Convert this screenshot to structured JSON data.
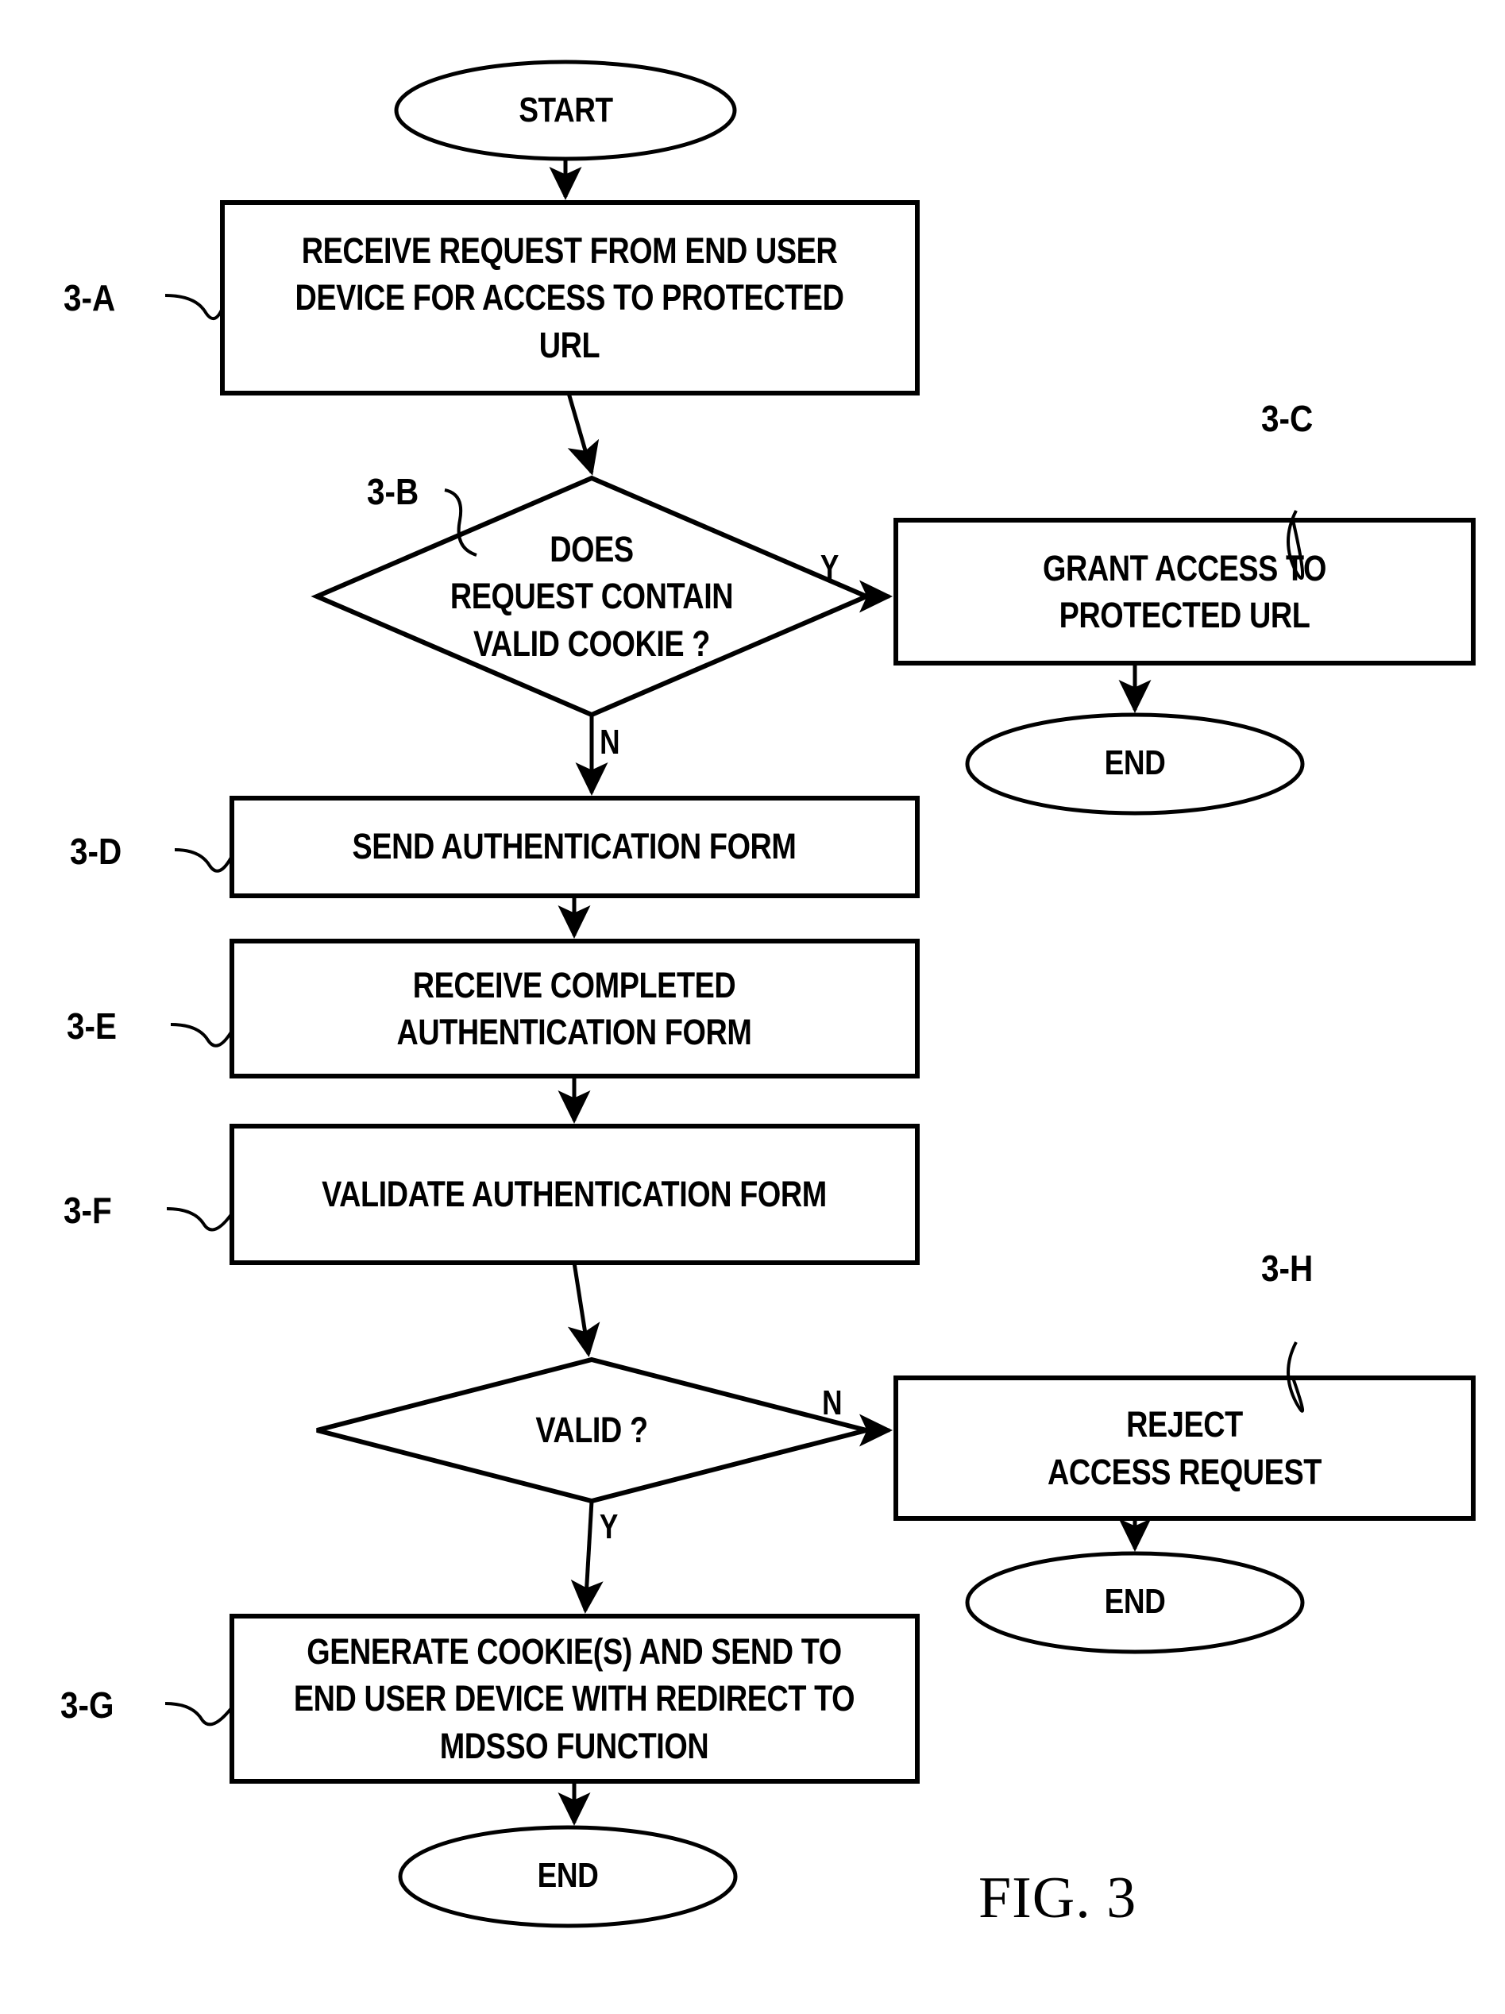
{
  "figure": {
    "caption": "FIG. 3",
    "colors": {
      "stroke": "#000000",
      "background": "#ffffff",
      "text": "#000000"
    }
  },
  "nodes": {
    "start": {
      "id": "start",
      "shape": "terminator",
      "label": "START"
    },
    "step_a": {
      "id": "3-A",
      "shape": "process",
      "ref": "3-A",
      "lines": [
        "RECEIVE REQUEST FROM END USER",
        "DEVICE FOR ACCESS TO PROTECTED",
        "URL"
      ]
    },
    "decision_b": {
      "id": "3-B",
      "shape": "decision",
      "ref": "3-B",
      "lines": [
        "DOES",
        "REQUEST CONTAIN",
        "VALID COOKIE ?"
      ]
    },
    "step_c": {
      "id": "3-C",
      "shape": "process",
      "ref": "3-C",
      "lines": [
        "GRANT ACCESS TO",
        "PROTECTED URL"
      ]
    },
    "end_c": {
      "id": "end-grant",
      "shape": "terminator",
      "label": "END"
    },
    "step_d": {
      "id": "3-D",
      "shape": "process",
      "ref": "3-D",
      "lines": [
        "SEND AUTHENTICATION FORM"
      ]
    },
    "step_e": {
      "id": "3-E",
      "shape": "process",
      "ref": "3-E",
      "lines": [
        "RECEIVE COMPLETED",
        "AUTHENTICATION FORM"
      ]
    },
    "step_f": {
      "id": "3-F",
      "shape": "process",
      "ref": "3-F",
      "lines": [
        "VALIDATE AUTHENTICATION FORM"
      ]
    },
    "decision_valid": {
      "id": "valid",
      "shape": "decision",
      "lines": [
        "VALID ?"
      ]
    },
    "step_h": {
      "id": "3-H",
      "shape": "process",
      "ref": "3-H",
      "lines": [
        "REJECT",
        "ACCESS REQUEST"
      ]
    },
    "end_h": {
      "id": "end-reject",
      "shape": "terminator",
      "label": "END"
    },
    "step_g": {
      "id": "3-G",
      "shape": "process",
      "ref": "3-G",
      "lines": [
        "GENERATE COOKIE(S) AND SEND TO",
        "END USER DEVICE WITH REDIRECT TO",
        "MDSSO FUNCTION"
      ]
    },
    "end_g": {
      "id": "end-generate",
      "shape": "terminator",
      "label": "END"
    }
  },
  "edge_labels": {
    "b_yes": "Y",
    "b_no": "N",
    "valid_no": "N",
    "valid_yes": "Y"
  },
  "chart_data": {
    "type": "flowchart",
    "title": "FIG. 3",
    "nodes": [
      {
        "ref": "",
        "type": "terminator",
        "text": "START"
      },
      {
        "ref": "3-A",
        "type": "process",
        "text": "RECEIVE REQUEST FROM END USER DEVICE FOR ACCESS TO PROTECTED URL"
      },
      {
        "ref": "3-B",
        "type": "decision",
        "text": "DOES REQUEST CONTAIN VALID COOKIE ?"
      },
      {
        "ref": "3-C",
        "type": "process",
        "text": "GRANT ACCESS TO PROTECTED URL"
      },
      {
        "ref": "",
        "type": "terminator",
        "text": "END"
      },
      {
        "ref": "3-D",
        "type": "process",
        "text": "SEND AUTHENTICATION FORM"
      },
      {
        "ref": "3-E",
        "type": "process",
        "text": "RECEIVE COMPLETED AUTHENTICATION FORM"
      },
      {
        "ref": "3-F",
        "type": "process",
        "text": "VALIDATE AUTHENTICATION FORM"
      },
      {
        "ref": "",
        "type": "decision",
        "text": "VALID ?"
      },
      {
        "ref": "3-H",
        "type": "process",
        "text": "REJECT ACCESS REQUEST"
      },
      {
        "ref": "",
        "type": "terminator",
        "text": "END"
      },
      {
        "ref": "3-G",
        "type": "process",
        "text": "GENERATE COOKIE(S) AND SEND TO END USER DEVICE WITH REDIRECT TO MDSSO FUNCTION"
      },
      {
        "ref": "",
        "type": "terminator",
        "text": "END"
      }
    ],
    "edges": [
      {
        "from": "START",
        "to": "3-A",
        "label": ""
      },
      {
        "from": "3-A",
        "to": "3-B",
        "label": ""
      },
      {
        "from": "3-B",
        "to": "3-C",
        "label": "Y"
      },
      {
        "from": "3-B",
        "to": "3-D",
        "label": "N"
      },
      {
        "from": "3-C",
        "to": "END",
        "label": ""
      },
      {
        "from": "3-D",
        "to": "3-E",
        "label": ""
      },
      {
        "from": "3-E",
        "to": "3-F",
        "label": ""
      },
      {
        "from": "3-F",
        "to": "VALID ?",
        "label": ""
      },
      {
        "from": "VALID ?",
        "to": "3-H",
        "label": "N"
      },
      {
        "from": "VALID ?",
        "to": "3-G",
        "label": "Y"
      },
      {
        "from": "3-H",
        "to": "END",
        "label": ""
      },
      {
        "from": "3-G",
        "to": "END",
        "label": ""
      }
    ]
  }
}
